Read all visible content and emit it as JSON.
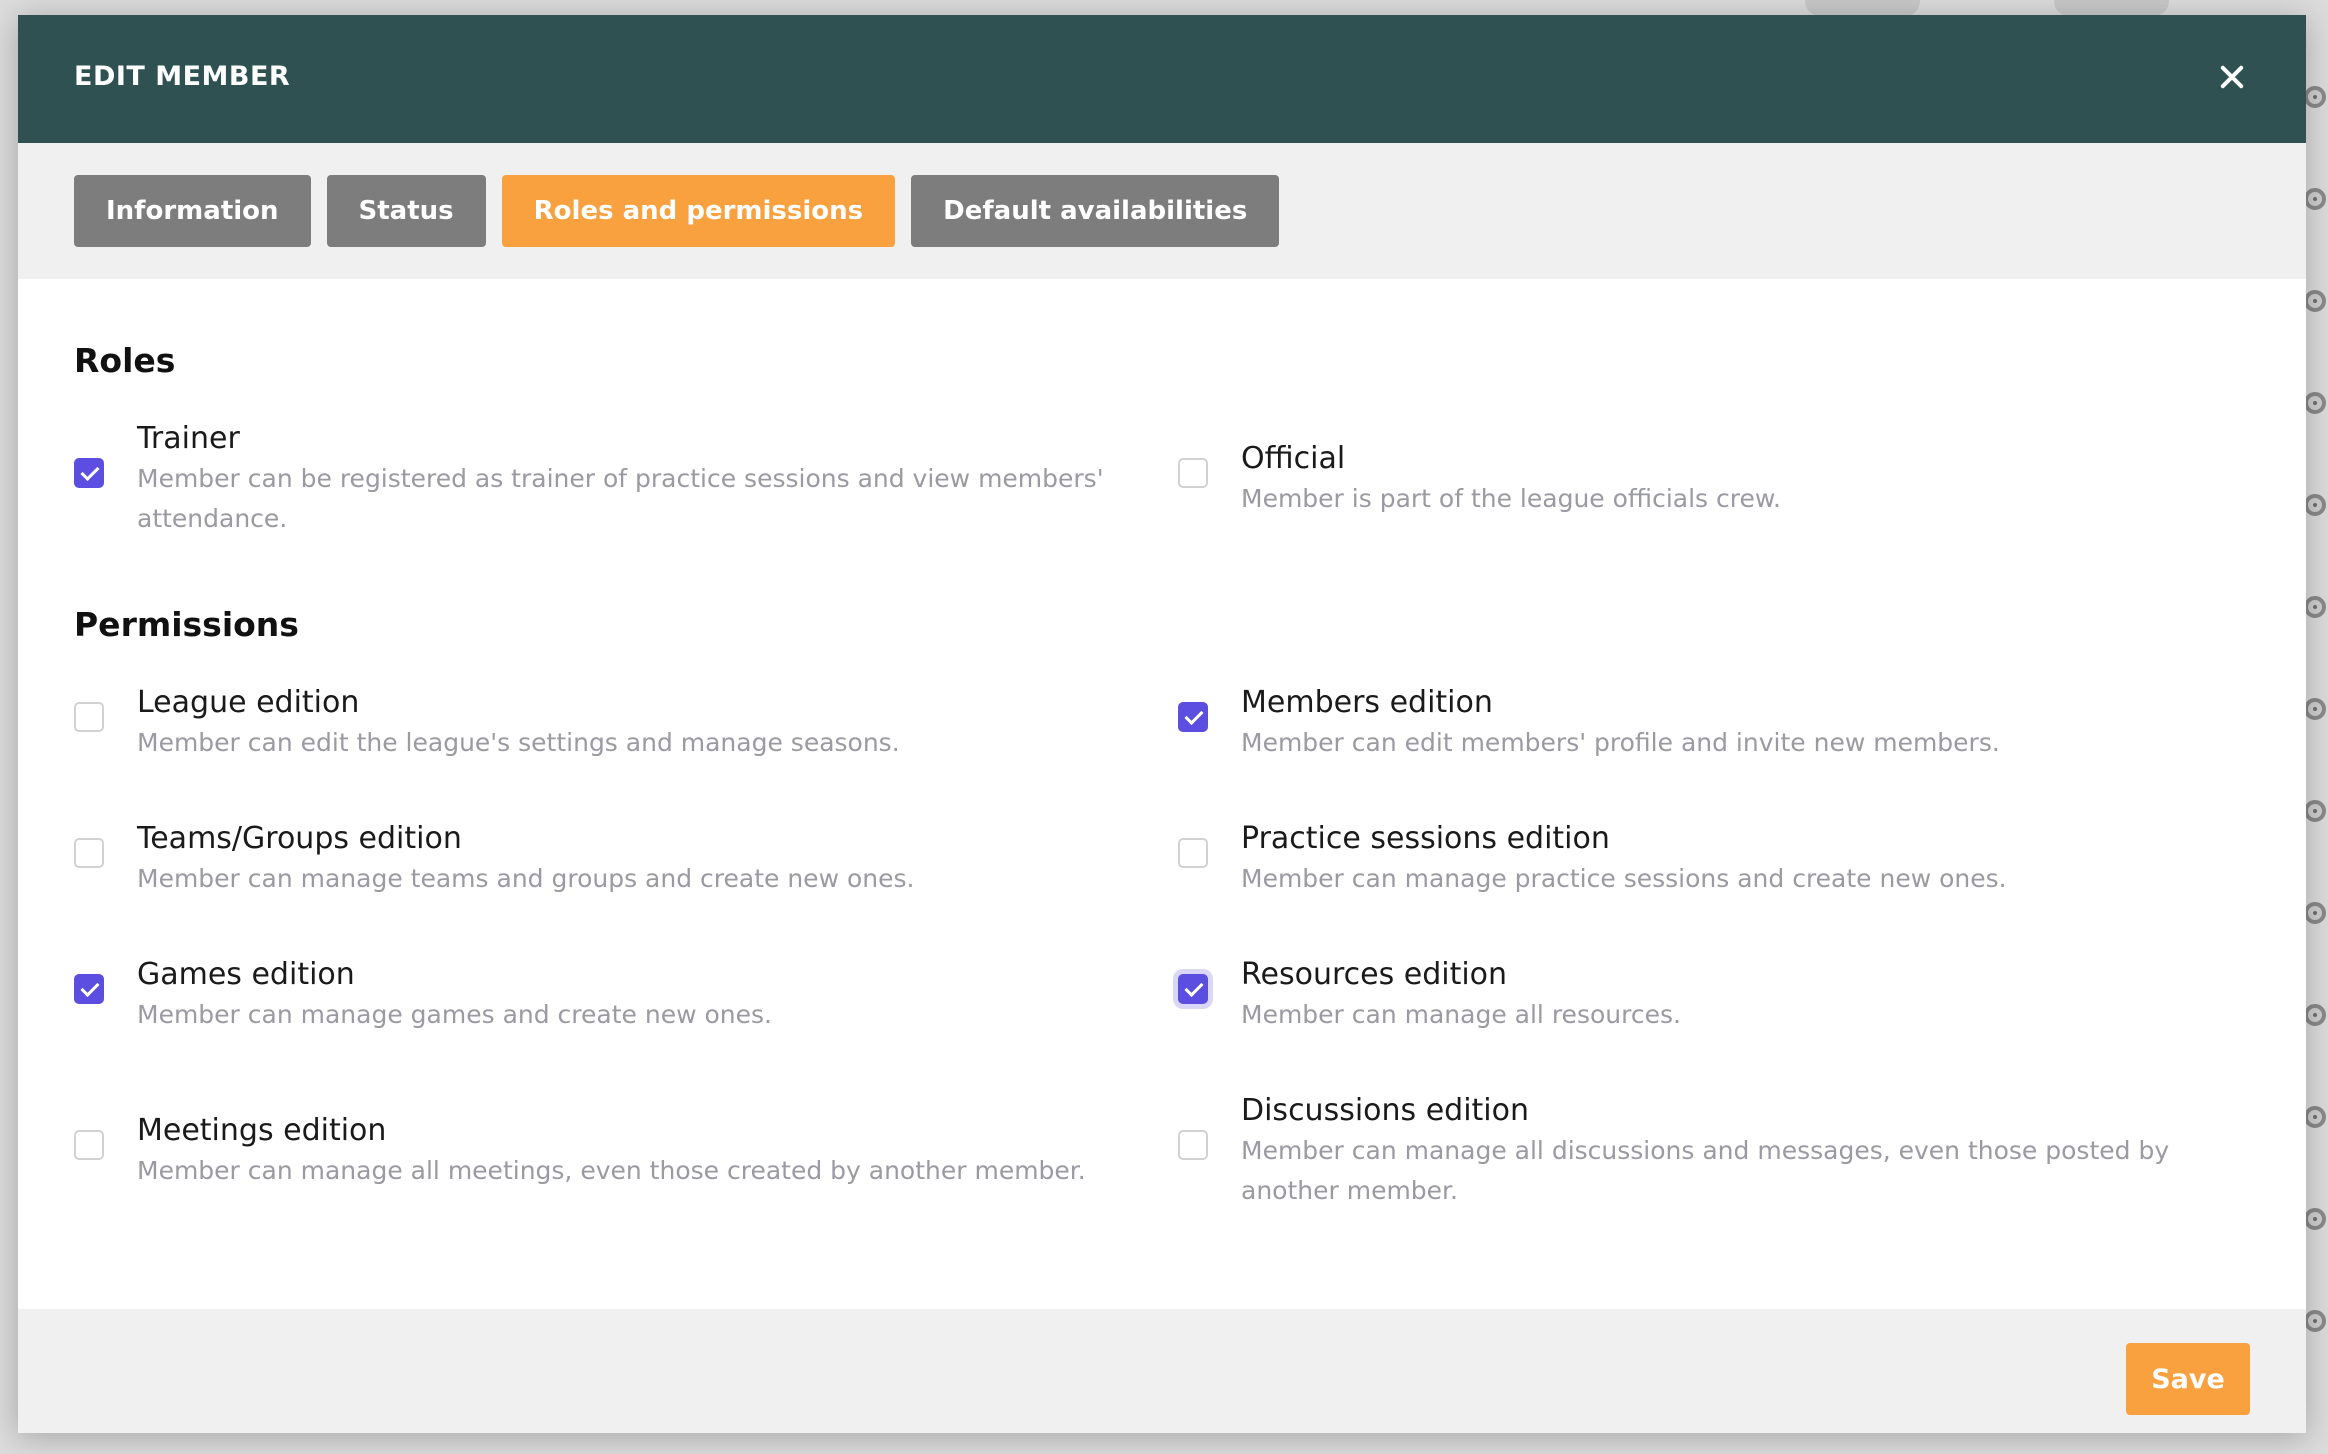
{
  "modal": {
    "title": "EDIT MEMBER",
    "tabs": [
      {
        "label": "Information",
        "active": false
      },
      {
        "label": "Status",
        "active": false
      },
      {
        "label": "Roles and permissions",
        "active": true
      },
      {
        "label": "Default availabilities",
        "active": false
      }
    ],
    "roles_title": "Roles",
    "permissions_title": "Permissions",
    "roles": [
      {
        "label": "Trainer",
        "description": "Member can be registered as trainer of practice sessions and view members' attendance.",
        "checked": true
      },
      {
        "label": "Official",
        "description": "Member is part of the league officials crew.",
        "checked": false
      }
    ],
    "permissions": [
      {
        "label": "League edition",
        "description": "Member can edit the league's settings and manage seasons.",
        "checked": false
      },
      {
        "label": "Members edition",
        "description": "Member can edit members' profile and invite new members.",
        "checked": true
      },
      {
        "label": "Teams/Groups edition",
        "description": "Member can manage teams and groups and create new ones.",
        "checked": false
      },
      {
        "label": "Practice sessions edition",
        "description": "Member can manage practice sessions and create new ones.",
        "checked": false
      },
      {
        "label": "Games edition",
        "description": "Member can manage games and create new ones.",
        "checked": true
      },
      {
        "label": "Resources edition",
        "description": "Member can manage all resources.",
        "checked": true,
        "focused": true
      },
      {
        "label": "Meetings edition",
        "description": "Member can manage all meetings, even those created by another member.",
        "checked": false
      },
      {
        "label": "Discussions edition",
        "description": "Member can manage all discussions and messages, even those posted by another member.",
        "checked": false
      }
    ],
    "save_label": "Save"
  },
  "colors": {
    "header": "#2f5152",
    "accent": "#f9a03f",
    "tab_inactive": "#7d7d7d",
    "checkbox_checked": "#5b4ee0"
  },
  "icons": {
    "close": "close-icon",
    "check": "check-icon"
  }
}
